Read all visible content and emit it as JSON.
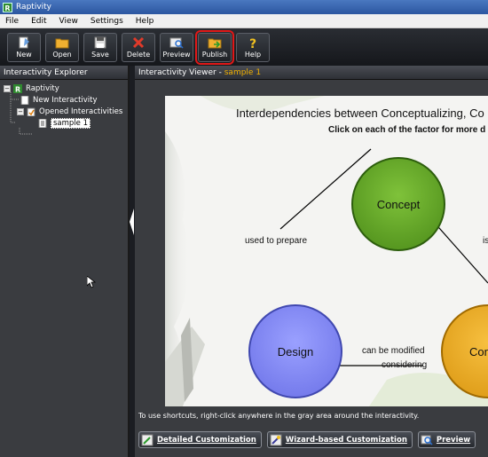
{
  "window": {
    "title": "Raptivity",
    "app_icon_letter": "R"
  },
  "menu": [
    "File",
    "Edit",
    "View",
    "Settings",
    "Help"
  ],
  "toolbar": {
    "buttons": [
      {
        "label": "New",
        "icon": "new-icon"
      },
      {
        "label": "Open",
        "icon": "folder-icon"
      },
      {
        "label": "Save",
        "icon": "floppy-icon"
      },
      {
        "label": "Delete",
        "icon": "delete-icon"
      },
      {
        "label": "Preview",
        "icon": "preview-icon"
      },
      {
        "label": "Publish",
        "icon": "publish-icon",
        "highlighted": true
      },
      {
        "label": "Help",
        "icon": "help-icon"
      }
    ]
  },
  "explorer": {
    "title": "Interactivity Explorer",
    "tree": {
      "root": "Raptivity",
      "new_item": "New Interactivity",
      "opened": "Opened Interactivities",
      "sample": "sample 1"
    }
  },
  "viewer": {
    "title_prefix": "Interactivity Viewer - ",
    "title_accent": "sample 1",
    "stage": {
      "title": "Interdependencies between Conceptualizing, Co",
      "subtitle": "Click on each of the factor for more d",
      "nodes": {
        "concept": "Concept",
        "design": "Design",
        "cons": "Con"
      },
      "edge_labels": {
        "used_to_prepare": "used to prepare",
        "right_cut": "is",
        "modified_line1": "can be modified",
        "modified_line2": "considering"
      }
    },
    "hint": "To use shortcuts, right-click anywhere in the gray area around the interactivity.",
    "buttons": {
      "detailed": "Detailed Customization",
      "wizard": "Wizard-based Customization",
      "preview": "Preview"
    }
  },
  "colors": {
    "toolbar_bg": "#1e2126",
    "highlight": "#e01818",
    "accent": "#f0b000",
    "concept": "#5a9a22",
    "design": "#7a80f0",
    "cons": "#e8a820"
  }
}
